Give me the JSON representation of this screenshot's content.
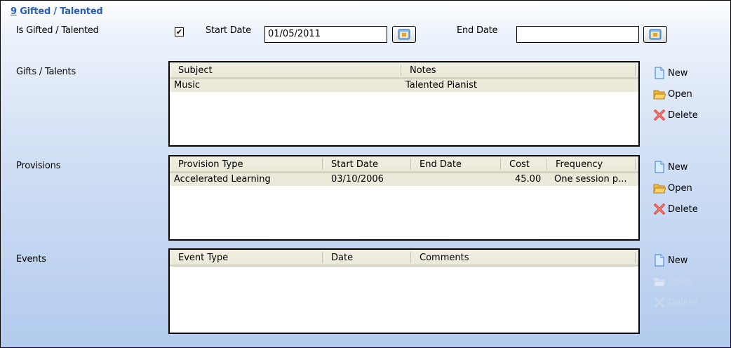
{
  "section": {
    "number": "9",
    "title": "Gifted / Talented"
  },
  "gifted_row": {
    "label": "Is Gifted / Talented",
    "checked_glyph": "✔",
    "start_label": "Start Date",
    "start_value": "01/05/2011",
    "end_label": "End Date",
    "end_value": ""
  },
  "gifts": {
    "label": "Gifts / Talents",
    "columns": [
      "Subject",
      "Notes"
    ],
    "rows": [
      [
        "Music",
        "Talented Pianist"
      ]
    ]
  },
  "provisions": {
    "label": "Provisions",
    "columns": [
      "Provision Type",
      "Start Date",
      "End Date",
      "Cost",
      "Frequency"
    ],
    "rows": [
      [
        "Accelerated Learning",
        "03/10/2006",
        "",
        "45.00",
        "One session p..."
      ]
    ]
  },
  "events": {
    "label": "Events",
    "columns": [
      "Event Type",
      "Date",
      "Comments"
    ],
    "rows": []
  },
  "actions": {
    "new": "New",
    "open": "Open",
    "delete": "Delete"
  },
  "colors": {
    "section_title": "#2b5fb8",
    "row_highlight": "#ebe9d9",
    "disabled_text": "#c9d7ec"
  },
  "icons": [
    "checkbox-checked-icon",
    "calendar-icon",
    "new-document-icon",
    "open-folder-icon",
    "delete-x-icon"
  ]
}
